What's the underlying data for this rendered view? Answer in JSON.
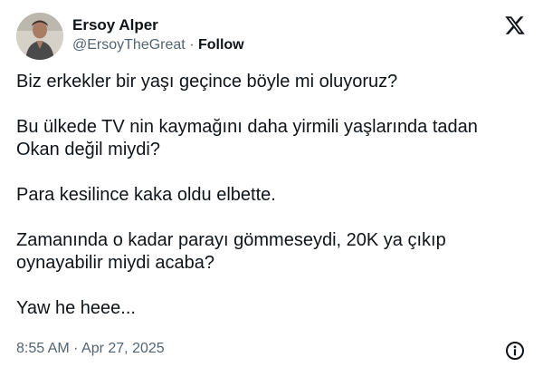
{
  "author": {
    "name": "Ersoy Alper",
    "handle": "@ErsoyTheGreat",
    "separator": "·",
    "follow_label": "Follow"
  },
  "tweet": {
    "paragraphs": [
      "Biz erkekler bir yaşı geçince böyle mi oluyoruz?",
      "Bu ülkede TV nin kaymağını daha yirmili yaşlarında tadan Okan değil miydi?",
      "Para kesilince kaka oldu elbette.",
      "Zamanında o kadar parayı gömmeseydi, 20K ya çıkıp oynayabilir miydi acaba?",
      "Yaw he heee..."
    ],
    "timestamp": "8:55 AM · Apr 27, 2025"
  },
  "icons": {
    "brand": "x-logo-icon",
    "info": "info-icon"
  },
  "colors": {
    "text_primary": "#0f1419",
    "text_secondary": "#536471",
    "background": "#ffffff"
  }
}
